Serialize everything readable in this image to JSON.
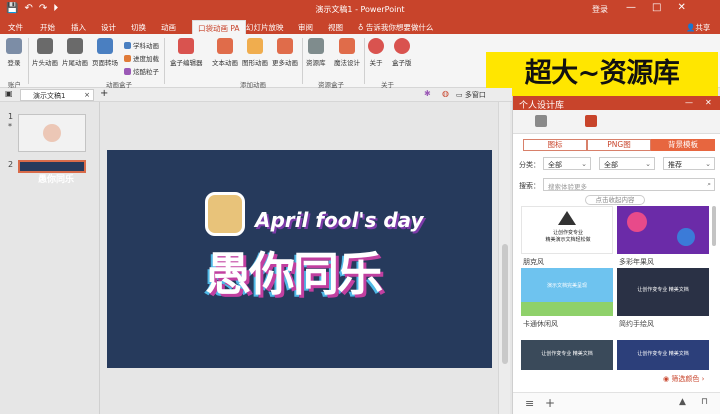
{
  "window": {
    "title": "演示文稿1 - PowerPoint",
    "login": "登录",
    "min": "—",
    "max": "□",
    "close": "✕"
  },
  "quick_access": {
    "save": "💾",
    "undo": "↶",
    "redo": "↷",
    "start": "⏵"
  },
  "menu": {
    "tabs": [
      "文件",
      "开始",
      "插入",
      "设计",
      "切换",
      "动画",
      "口袋动画 PA",
      "幻灯片放映",
      "审阅",
      "视图"
    ],
    "tell_me": "告诉我你想要做什么",
    "share": "共享"
  },
  "ribbon": {
    "login": "登录",
    "account": "账户",
    "head_anim": "片头动画",
    "tail_anim": "片尾动画",
    "page_switch": "页面转场",
    "sci_anim": "学科动画",
    "progress": "进度加载",
    "particles": "炫酷粒子",
    "anim_group": "动画盒子",
    "box_editor": "盒子编辑器",
    "text_anim": "文本动画",
    "shape_anim": "图形动画",
    "more_anim": "更多动画",
    "add_group": "添加动画",
    "resource": "资源库",
    "magic": "魔法设计",
    "res_group": "资源盒子",
    "about": "关于",
    "box_ver": "盒子版",
    "about_group": "关于"
  },
  "banner": {
    "text": "超大~资源库"
  },
  "doc": {
    "tab": "演示文稿1",
    "add": "+",
    "multi_window": "多窗口"
  },
  "slides": [
    {
      "num": "1",
      "star": "*"
    },
    {
      "num": "2"
    }
  ],
  "slide": {
    "line1": "April fool's day",
    "line2": "愚你同乐"
  },
  "panel": {
    "title": "个人设计库",
    "min": "—",
    "close": "✕",
    "tabs": [
      "图标",
      "PNG图",
      "背景模板"
    ],
    "cat_label": "分类：",
    "cat_value": "全部",
    "cat_value2": "全部",
    "sort_value": "推荐",
    "search_label": "搜索：",
    "search_placeholder": "搜索体验更多",
    "hint": "点击收起内容",
    "cards": [
      {
        "label": "朋克风",
        "text": "让创作变专业\n精美演示文档轻松做"
      },
      {
        "label": "多彩年果风"
      },
      {
        "label": "卡通休闲风",
        "text": "演示文档完美呈现"
      },
      {
        "label": "简约手绘风",
        "text": "让创作变专业 精美文档"
      },
      {
        "text": "让创作变专业 精美文档"
      },
      {
        "text": "让创作变专业 精美文档"
      }
    ],
    "filter": "筛选颜色 ›"
  },
  "colors": {
    "accent": "#c8442b",
    "banner": "#ffe600",
    "slide_bg": "#263a5c"
  }
}
